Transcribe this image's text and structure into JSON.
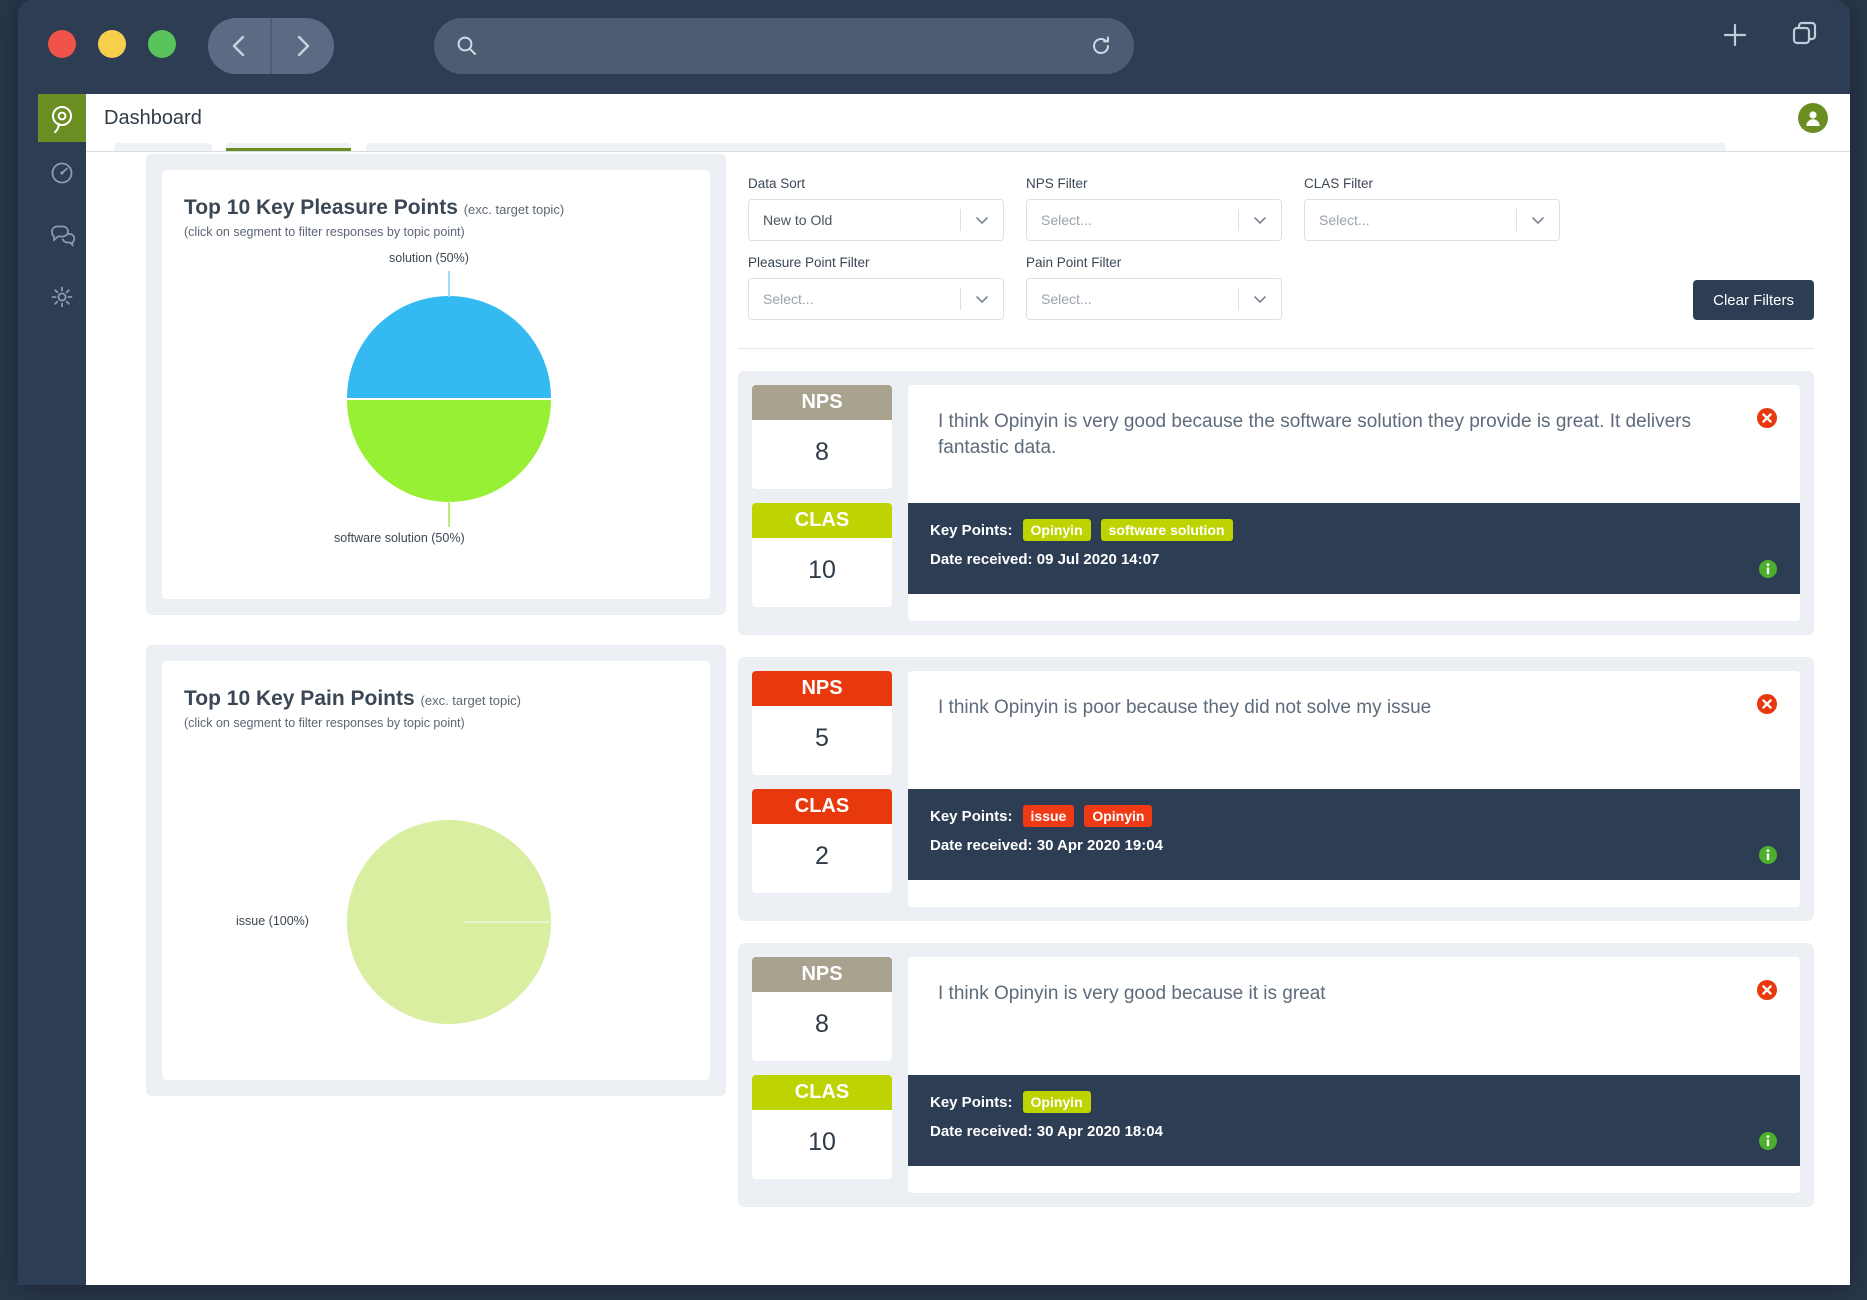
{
  "browser": {
    "back_icon": "chevron-left-icon",
    "forward_icon": "chevron-right-icon",
    "search_icon": "search-icon",
    "reload_icon": "reload-icon",
    "url_value": "",
    "url_placeholder": "",
    "new_tab_icon": "plus-icon",
    "tabs_icon": "copy-tabs-icon"
  },
  "app": {
    "logo_icon": "opinyin-logo-icon",
    "page_title": "Dashboard",
    "avatar_icon": "user-avatar-icon",
    "sidebar": [
      {
        "icon": "speedometer-dashboard-icon",
        "name": "sidebar-item-dashboard"
      },
      {
        "icon": "chat-bubbles-icon",
        "name": "sidebar-item-responses"
      },
      {
        "icon": "gear-settings-icon",
        "name": "sidebar-item-settings"
      }
    ]
  },
  "filters": {
    "data_sort": {
      "label": "Data Sort",
      "value": "New to Old",
      "is_placeholder": false
    },
    "nps": {
      "label": "NPS Filter",
      "value": "Select...",
      "is_placeholder": true
    },
    "clas": {
      "label": "CLAS Filter",
      "value": "Select...",
      "is_placeholder": true
    },
    "pleasure_point": {
      "label": "Pleasure Point Filter",
      "value": "Select...",
      "is_placeholder": true
    },
    "pain_point": {
      "label": "Pain Point Filter",
      "value": "Select...",
      "is_placeholder": true
    },
    "clear_label": "Clear Filters",
    "caret_icon": "chevron-down-icon"
  },
  "charts": [
    {
      "title": "Top 10 Key Pleasure Points",
      "title_suffix": "(exc. target topic)",
      "note": "(click on segment to filter responses by topic point)"
    },
    {
      "title": "Top 10 Key Pain Points",
      "title_suffix": "(exc. target topic)",
      "note": "(click on segment to filter responses by topic point)"
    }
  ],
  "chart_data": [
    {
      "type": "pie",
      "title": "Top 10 Key Pleasure Points (exc. target topic)",
      "subtitle": "(click on segment to filter responses by topic point)",
      "labels": [
        "solution",
        "software solution"
      ],
      "values": [
        50,
        50
      ],
      "value_unit": "%",
      "data_labels": [
        "solution (50%)",
        "software solution (50%)"
      ],
      "colors": [
        "#35b9f1",
        "#97f034"
      ],
      "legend": "none",
      "grid": false
    },
    {
      "type": "pie",
      "title": "Top 10 Key Pain Points (exc. target topic)",
      "subtitle": "(click on segment to filter responses by topic point)",
      "labels": [
        "issue"
      ],
      "values": [
        100
      ],
      "value_unit": "%",
      "data_labels": [
        "issue (100%)"
      ],
      "colors": [
        "#d9eea0"
      ],
      "legend": "none",
      "grid": false
    }
  ],
  "responses": [
    {
      "nps_label": "NPS",
      "nps_value": "8",
      "nps_color": "#a9a28f",
      "clas_label": "CLAS",
      "clas_value": "10",
      "clas_color": "#bdd402",
      "text": "I think Opinyin is very good because the software solution they provide is great. It delivers fantastic data.",
      "key_points_label": "Key Points:",
      "tags": [
        "Opinyin",
        "software solution"
      ],
      "tag_color": "#bdd402",
      "date_label": "Date received:",
      "date_value": "09 Jul 2020 14:07",
      "delete_icon": "delete-circle-icon",
      "info_icon": "info-circle-icon"
    },
    {
      "nps_label": "NPS",
      "nps_value": "5",
      "nps_color": "#e8380d",
      "clas_label": "CLAS",
      "clas_value": "2",
      "clas_color": "#e8380d",
      "text": "I think Opinyin is poor because they did not solve my issue",
      "key_points_label": "Key Points:",
      "tags": [
        "issue",
        "Opinyin"
      ],
      "tag_color": "#ef3a15",
      "date_label": "Date received:",
      "date_value": "30 Apr 2020 19:04",
      "delete_icon": "delete-circle-icon",
      "info_icon": "info-circle-icon"
    },
    {
      "nps_label": "NPS",
      "nps_value": "8",
      "nps_color": "#a9a28f",
      "clas_label": "CLAS",
      "clas_value": "10",
      "clas_color": "#bdd402",
      "text": "I think Opinyin is very good because it is great",
      "key_points_label": "Key Points:",
      "tags": [
        "Opinyin"
      ],
      "tag_color": "#bdd402",
      "date_label": "Date received:",
      "date_value": "30 Apr 2020 18:04",
      "delete_icon": "delete-circle-icon",
      "info_icon": "info-circle-icon"
    }
  ]
}
